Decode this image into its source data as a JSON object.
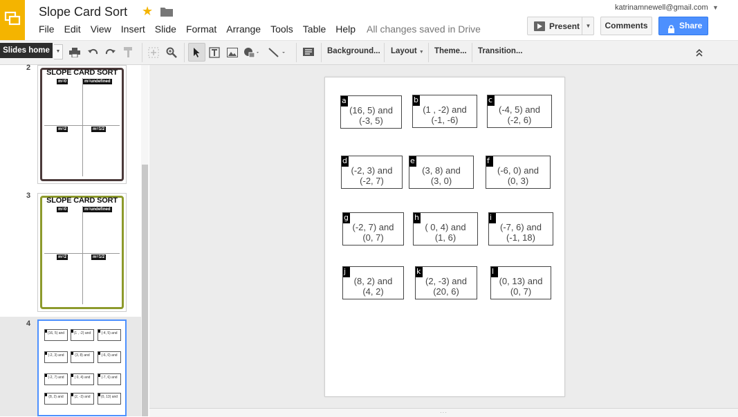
{
  "app": {
    "doc_title": "Slope Card Sort",
    "tooltip": "Slides home",
    "save_status": "All changes saved in Drive",
    "user_email": "katrinamnewell@gmail.com",
    "accent": "#f4b400",
    "share_color": "#4d90fe"
  },
  "menu": [
    "File",
    "Edit",
    "View",
    "Insert",
    "Slide",
    "Format",
    "Arrange",
    "Tools",
    "Table",
    "Help"
  ],
  "buttons": {
    "present": "Present",
    "comments": "Comments",
    "share": "Share"
  },
  "toolbar": {
    "background": "Background...",
    "layout": "Layout",
    "theme": "Theme...",
    "transition": "Transition..."
  },
  "filmstrip": {
    "slides": [
      {
        "number": "2",
        "title": "SLOPE CARD SORT",
        "labels": [
          "m=0",
          "m=undefined",
          "m=2",
          "m=1/2"
        ]
      },
      {
        "number": "3",
        "title": "SLOPE CARD SORT",
        "labels": [
          "m=0",
          "m=undefined",
          "m=2",
          "m=1/2"
        ]
      },
      {
        "number": "4"
      }
    ]
  },
  "cards": [
    {
      "tag": "a",
      "line1": "(16, 5) and",
      "line2": "(-3, 5)"
    },
    {
      "tag": "b",
      "line1": "(1 , -2) and",
      "line2": "(-1, -6)"
    },
    {
      "tag": "c",
      "line1": "(-4, 5) and",
      "line2": "(-2, 6)"
    },
    {
      "tag": "d",
      "line1": "(-2, 3) and",
      "line2": "(-2, 7)"
    },
    {
      "tag": "e",
      "line1": "(3, 8) and",
      "line2": "(3, 0)"
    },
    {
      "tag": "f",
      "line1": "(-6, 0) and",
      "line2": "(0, 3)"
    },
    {
      "tag": "g",
      "line1": "(-2, 7) and",
      "line2": "(0, 7)"
    },
    {
      "tag": "h",
      "line1": "( 0, 4) and",
      "line2": "(1, 6)"
    },
    {
      "tag": "i",
      "line1": "(-7, 6) and",
      "line2": "(-1, 18)"
    },
    {
      "tag": "j",
      "line1": "(8, 2) and",
      "line2": "(4, 2)"
    },
    {
      "tag": "k",
      "line1": "(2, -3) and",
      "line2": "(20, 6)"
    },
    {
      "tag": "l",
      "line1": "(0, 13) and",
      "line2": "(0, 7)"
    }
  ]
}
